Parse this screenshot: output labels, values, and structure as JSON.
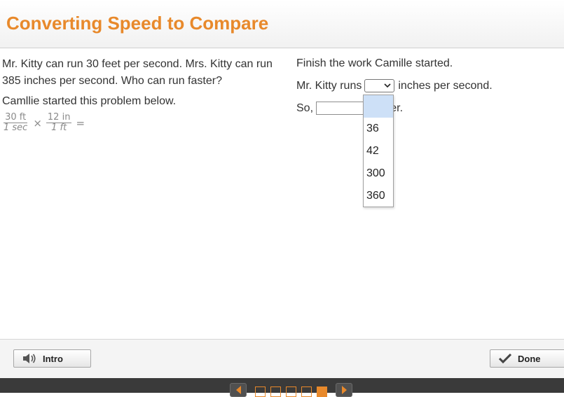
{
  "header": {
    "title": "Converting Speed to Compare"
  },
  "problem": {
    "text": "Mr. Kitty can run 30 feet per second. Mrs. Kitty can run 385 inches per second. Who can run faster?",
    "started_text": "Camllie started this problem below.",
    "expression": {
      "frac1_num": "30 ft",
      "frac1_den": "1 sec",
      "times": "×",
      "frac2_num": "12 in",
      "frac2_den": "1 ft",
      "equals": "="
    }
  },
  "work": {
    "instruction": "Finish the work Camille started.",
    "line1_before": "Mr. Kitty runs",
    "line1_after": "inches per second.",
    "line2_before": "So,",
    "line2_after": "s faster."
  },
  "dropdown": {
    "options": [
      "",
      "36",
      "42",
      "300",
      "360"
    ],
    "selected_index": 0
  },
  "footer": {
    "intro_label": "Intro",
    "done_label": "Done"
  },
  "pager": {
    "total": 5,
    "current": 5
  },
  "colors": {
    "accent": "#e8892b",
    "selection": "#cde0f7"
  }
}
